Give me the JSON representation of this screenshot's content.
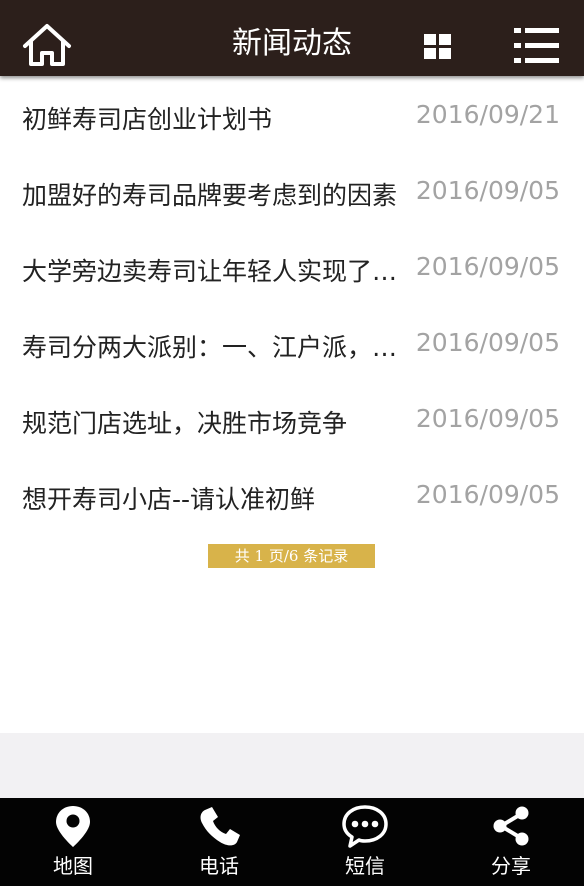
{
  "header": {
    "title": "新闻动态",
    "home_icon": "home-icon",
    "grid_icon": "grid-icon",
    "menu_icon": "menu-list-icon",
    "bg_color": "#2c1f1b"
  },
  "news": [
    {
      "title": "初鲜寿司店创业计划书",
      "date": "2016/09/21"
    },
    {
      "title": "加盟好的寿司品牌要考虑到的因素",
      "date": "2016/09/05"
    },
    {
      "title": "大学旁边卖寿司让年轻人实现了创业梦",
      "date": "2016/09/05"
    },
    {
      "title": "寿司分两大派别：一、江户派，二、关西派",
      "date": "2016/09/05"
    },
    {
      "title": "规范门店选址，决胜市场竞争",
      "date": "2016/09/05"
    },
    {
      "title": "想开寿司小店--请认准初鲜",
      "date": "2016/09/05"
    }
  ],
  "pager": {
    "text": "共 1 页/6 条记录",
    "bg_color": "#d8b34a"
  },
  "footer": {
    "items": [
      {
        "label": "地图",
        "icon": "map-pin-icon"
      },
      {
        "label": "电话",
        "icon": "phone-icon"
      },
      {
        "label": "短信",
        "icon": "sms-icon"
      },
      {
        "label": "分享",
        "icon": "share-icon"
      }
    ]
  }
}
